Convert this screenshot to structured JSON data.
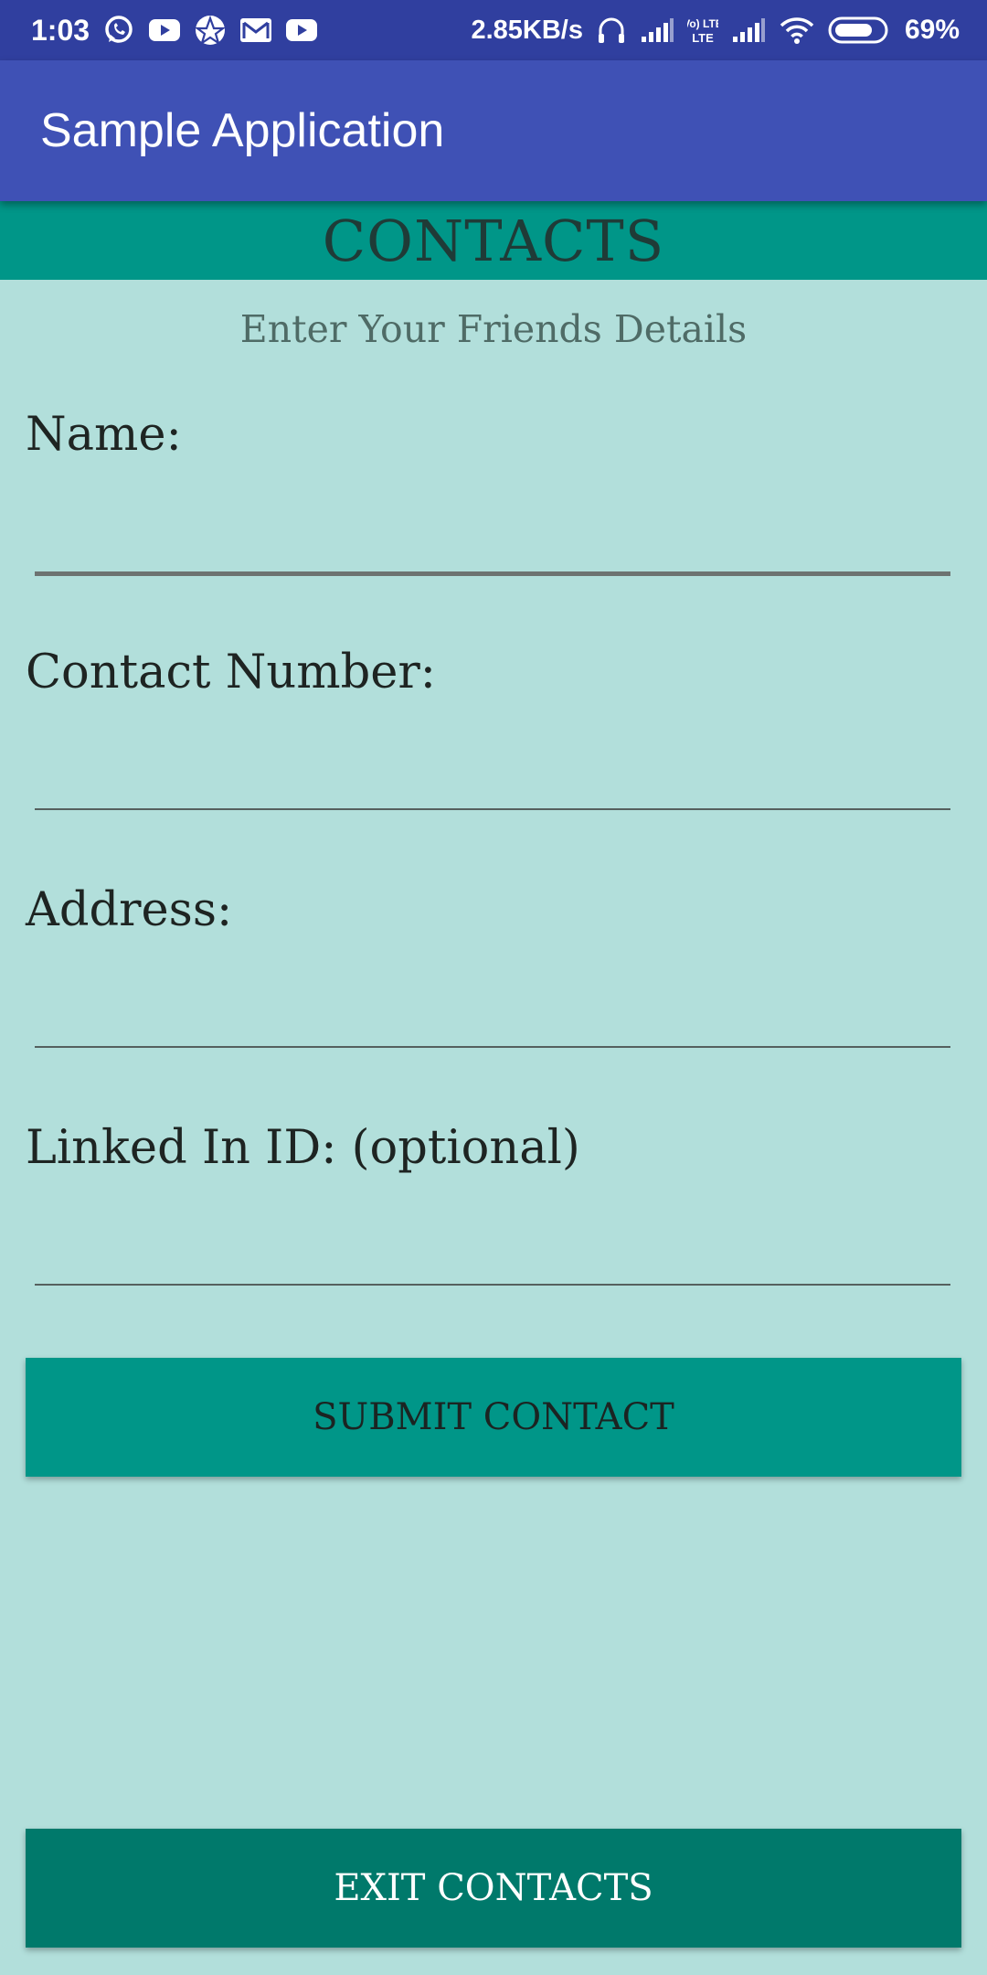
{
  "status_bar": {
    "time": "1:03",
    "net_speed": "2.85KB/s",
    "battery_percent": "69%",
    "left_icons": [
      "whatsapp-icon",
      "youtube-icon",
      "app-icon",
      "gmail-icon",
      "youtube-icon"
    ],
    "right_icons": [
      "headphones-icon",
      "signal-icon",
      "volte-icon",
      "signal-icon",
      "wifi-icon",
      "battery-icon"
    ],
    "volte_label": "Vo) LTE"
  },
  "app_bar": {
    "title": "Sample Application"
  },
  "header": {
    "title": "CONTACTS"
  },
  "form": {
    "subtitle": "Enter Your Friends Details",
    "fields": [
      {
        "label": "Name:",
        "value": "",
        "placeholder": ""
      },
      {
        "label": "Contact Number:",
        "value": "",
        "placeholder": ""
      },
      {
        "label": "Address:",
        "value": "",
        "placeholder": ""
      },
      {
        "label": "Linked In ID: (optional)",
        "value": "",
        "placeholder": ""
      }
    ]
  },
  "buttons": {
    "submit_label": "SUBMIT CONTACT",
    "exit_label": "EXIT CONTACTS"
  },
  "colors": {
    "status_bar": "#303f9f",
    "app_bar": "#3f51b5",
    "teal": "#009688",
    "dark_teal": "#00796b",
    "background": "#b2dfdb"
  }
}
